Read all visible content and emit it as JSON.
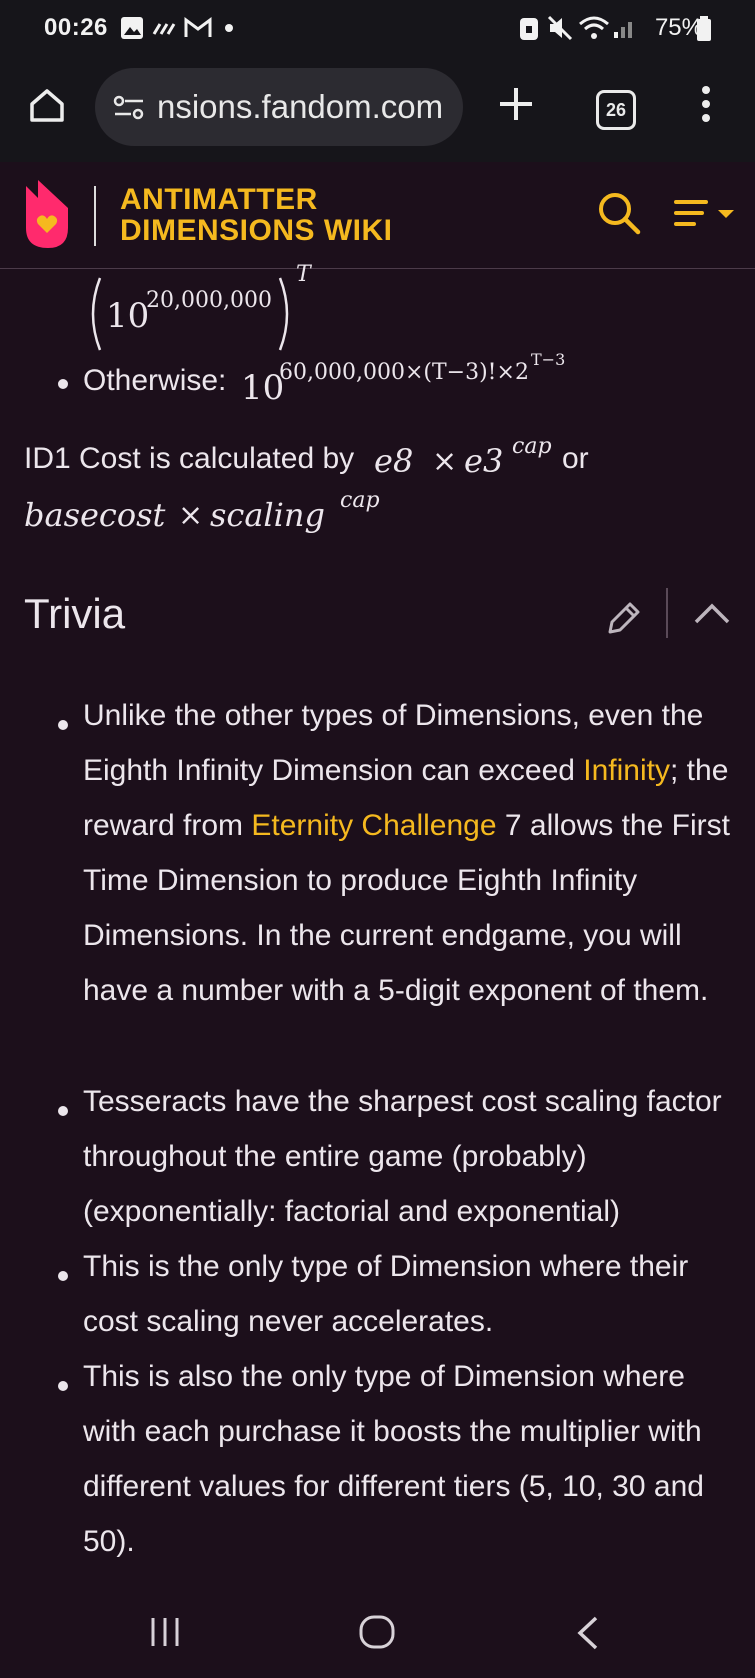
{
  "status_bar": {
    "time": "00:26",
    "battery": "75%",
    "icons": [
      "gallery-icon",
      "signal-dots-icon",
      "gmail-icon",
      "dot-icon",
      "lock-icon",
      "mute-icon",
      "wifi-icon",
      "cell-signal-icon",
      "battery-icon"
    ]
  },
  "browser": {
    "url": "nsions.fandom.com",
    "tab_count": "26",
    "icons": [
      "home-icon",
      "site-settings-icon",
      "new-tab-plus-icon",
      "tabs-icon",
      "more-vert-icon"
    ]
  },
  "wiki_header": {
    "title_line1": "ANTIMATTER",
    "title_line2": "DIMENSIONS WIKI",
    "accent_color": "#f5b91f",
    "logo_color": "#ff2a6d"
  },
  "formula": {
    "top_base": "10",
    "top_exp": "20,000,000",
    "top_outer_exp": "T",
    "otherwise_label": "Otherwise:",
    "otherwise_base": "10",
    "otherwise_exp": "60,000,000×(T−3)!×2",
    "otherwise_exp2": "T−3"
  },
  "id1_cost": {
    "prefix": "ID1 Cost is calculated by",
    "expr1_a": "e8",
    "times": "×",
    "expr1_b": "e3",
    "expr1_sup": "cap",
    "or_text": "or",
    "expr2_a": "basecost",
    "expr2_b": "scaling",
    "expr2_sup": "cap"
  },
  "trivia": {
    "heading": "Trivia",
    "items": [
      {
        "t1": "Unlike the other types of Dimensions, even the Eighth Infinity Dimension can exceed ",
        "link1": "Infinity",
        "t2": "; the reward from ",
        "link2": "Eternity Challenge",
        "t3": " 7 allows the First Time Dimension to produce Eighth Infinity Dimensions. In the current endgame, you will have a number with a 5-digit exponent of them."
      },
      {
        "text": "Tesseracts have the sharpest cost scaling factor throughout the entire game (probably) (exponentially: factorial and exponential)"
      },
      {
        "text": "This is the only type of Dimension where their cost scaling never accelerates."
      },
      {
        "text": "This is also the only type of Dimension where with each purchase it boosts the multiplier with different values for different tiers (5, 10, 30 and 50)."
      }
    ]
  },
  "nav_bar": {
    "icons": [
      "recents-icon",
      "home-circle-icon",
      "back-icon"
    ]
  }
}
